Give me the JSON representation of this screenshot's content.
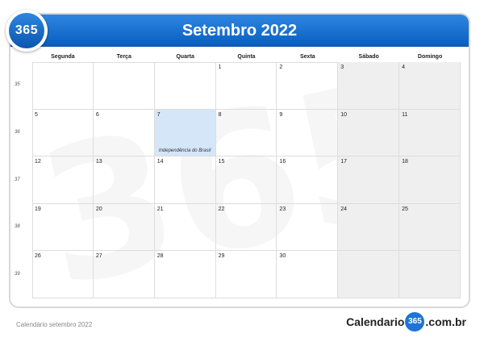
{
  "header": {
    "title": "Setembro 2022",
    "badge_text": "365",
    "accent_color": "#0a5fc2"
  },
  "calendar": {
    "weekdays": [
      "Segunda",
      "Terça",
      "Quarta",
      "Quinta",
      "Sexta",
      "Sábado",
      "Domingo"
    ],
    "week_numbers": [
      "35",
      "36",
      "37",
      "38",
      "39"
    ],
    "weeks": [
      [
        "",
        "",
        "",
        "1",
        "2",
        "3",
        "4"
      ],
      [
        "5",
        "6",
        "7",
        "8",
        "9",
        "10",
        "11"
      ],
      [
        "12",
        "13",
        "14",
        "15",
        "16",
        "17",
        "18"
      ],
      [
        "19",
        "20",
        "21",
        "22",
        "23",
        "24",
        "25"
      ],
      [
        "26",
        "27",
        "28",
        "29",
        "30",
        "",
        ""
      ]
    ],
    "holiday": {
      "day": "7",
      "label": "Independência do Brasil",
      "color": "#d5e6f8"
    },
    "weekend_color": "#efefef"
  },
  "watermark": "365",
  "footer": {
    "caption": "Calendário setembro 2022",
    "brand_prefix": "Calendario",
    "brand_badge": "365",
    "brand_suffix": ".com.br"
  }
}
